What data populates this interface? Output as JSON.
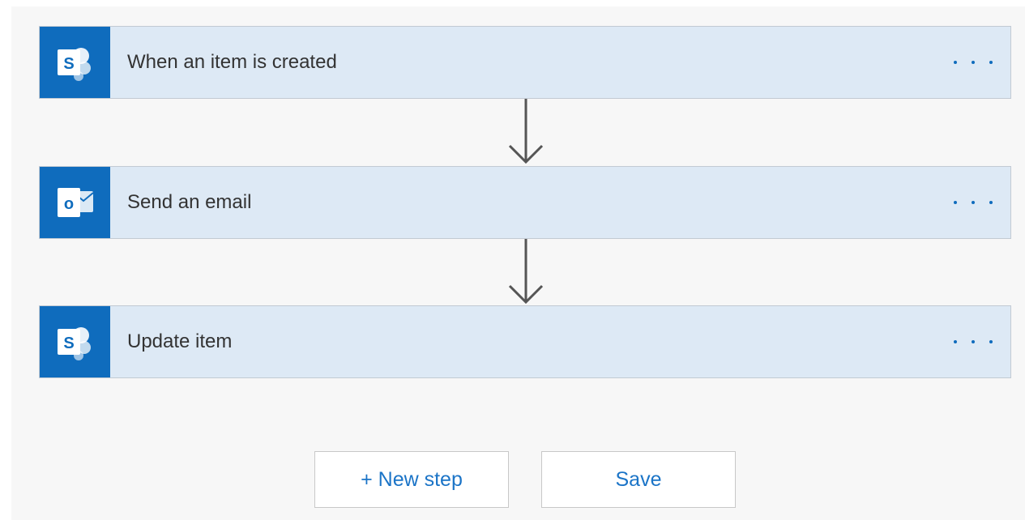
{
  "flow": {
    "steps": [
      {
        "label": "When an item is created",
        "icon": "sharepoint-icon",
        "icon_letter": "S"
      },
      {
        "label": "Send an email",
        "icon": "outlook-icon",
        "icon_letter": "o"
      },
      {
        "label": "Update item",
        "icon": "sharepoint-icon",
        "icon_letter": "S"
      }
    ]
  },
  "actions": {
    "new_step_label": "+ New step",
    "save_label": "Save"
  },
  "colors": {
    "step_background": "#dde9f5",
    "icon_background": "#0f6cbd",
    "accent": "#1b74c7",
    "arrow": "#555555",
    "canvas": "#f7f7f7"
  }
}
